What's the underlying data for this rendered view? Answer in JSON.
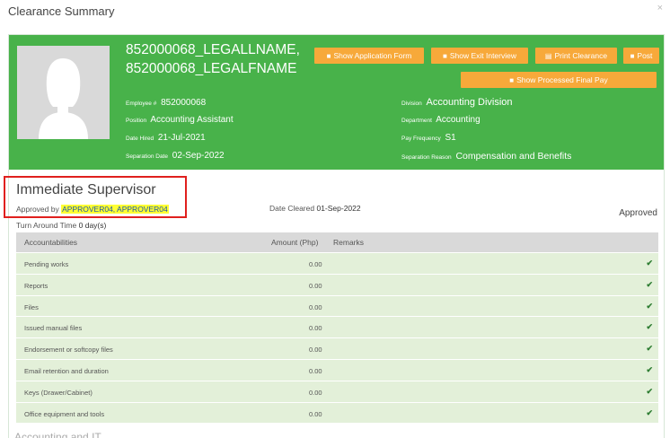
{
  "modal": {
    "title": "Clearance Summary",
    "close_label": "×"
  },
  "employee": {
    "name_line1": "852000068_LEGALLNAME,",
    "name_line2": "852000068_LEGALFNAME",
    "employee_no_label": "Employee #",
    "employee_no": "852000068",
    "position_label": "Position",
    "position": "Accounting Assistant",
    "date_hired_label": "Date Hired",
    "date_hired": "21-Jul-2021",
    "separation_date_label": "Separation Date",
    "separation_date": "02-Sep-2022",
    "division_label": "Division",
    "division": "Accounting Division",
    "department_label": "Department",
    "department": "Accounting",
    "pay_frequency_label": "Pay Frequency",
    "pay_frequency": "S1",
    "separation_reason_label": "Separation Reason",
    "separation_reason": "Compensation and Benefits"
  },
  "buttons": {
    "show_application_form": "Show Application Form",
    "show_exit_interview": "Show Exit Interview",
    "print_clearance": "Print Clearance",
    "post": "Post",
    "show_processed_final_pay": "Show Processed Final Pay"
  },
  "icons": {
    "file": "file-icon",
    "print": "print-icon",
    "check": "check-icon"
  },
  "colors": {
    "banner": "#48b24a",
    "button": "#f7a93a",
    "row": "#e3f0d9",
    "header_row": "#d9d9d9",
    "highlight_border": "#e0201e",
    "highlight_fill": "#ffff33"
  },
  "supervisor": {
    "title": "Immediate Supervisor",
    "approved_by_label": "Approved by",
    "approved_by": "APPROVER04, APPROVER04",
    "date_cleared_label": "Date Cleared",
    "date_cleared": "01-Sep-2022",
    "status": "Approved",
    "turn_around_label": "Turn Around Time",
    "turn_around": "0 day(s)",
    "columns": [
      "Accountabilities",
      "Amount (Php)",
      "Remarks"
    ],
    "rows": [
      {
        "item": "Pending works",
        "amount": "0.00",
        "check": "✔"
      },
      {
        "item": "Reports",
        "amount": "0.00",
        "check": "✔"
      },
      {
        "item": "Files",
        "amount": "0.00",
        "check": "✔"
      },
      {
        "item": "Issued manual files",
        "amount": "0.00",
        "check": "✔"
      },
      {
        "item": "Endorsement or softcopy files",
        "amount": "0.00",
        "check": "✔"
      },
      {
        "item": "Email retention and duration",
        "amount": "0.00",
        "check": "✔"
      },
      {
        "item": "Keys (Drawer/Cabinet)",
        "amount": "0.00",
        "check": "✔"
      },
      {
        "item": "Office equipment and tools",
        "amount": "0.00",
        "check": "✔"
      }
    ]
  },
  "next_section_title": "Accounting and IT"
}
